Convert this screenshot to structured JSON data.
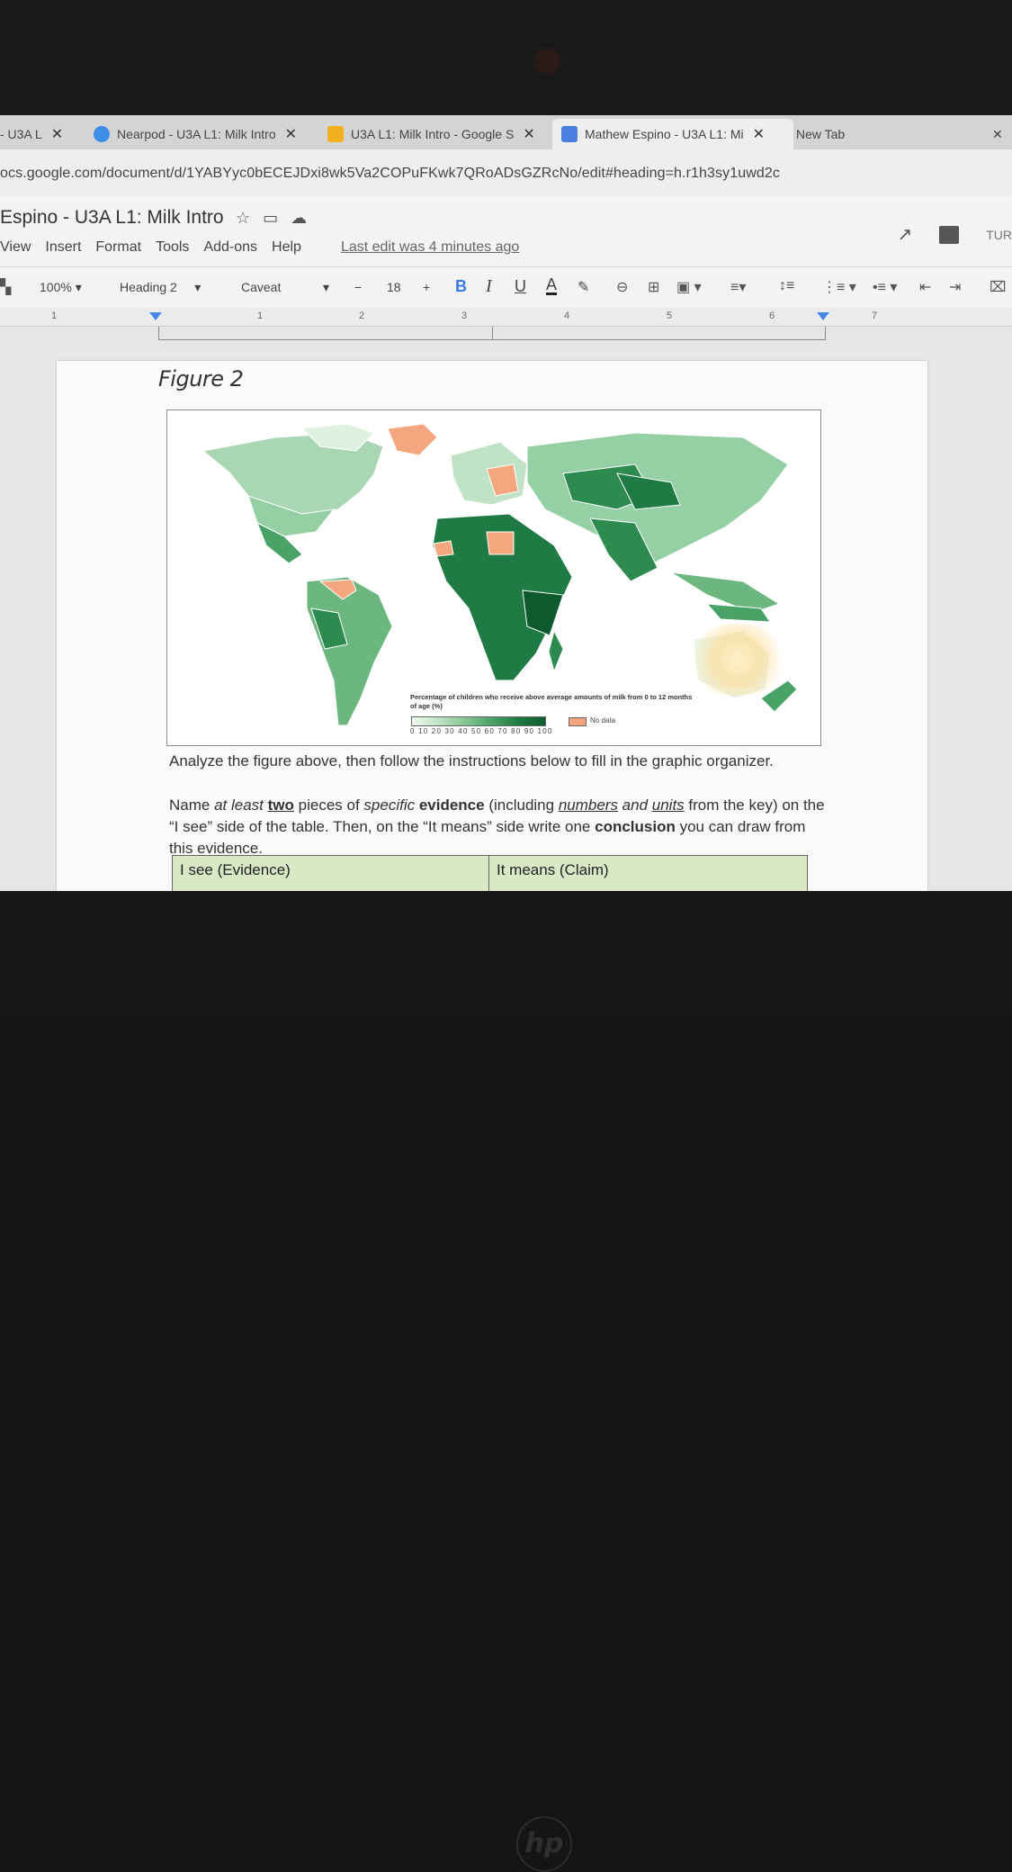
{
  "tabs": [
    {
      "label": "- U3A L",
      "favicon": "docs"
    },
    {
      "label": "Nearpod - U3A L1: Milk Intro",
      "favicon": "nearpod"
    },
    {
      "label": "U3A L1: Milk Intro - Google S",
      "favicon": "slides"
    },
    {
      "label": "Mathew Espino - U3A L1: Mi",
      "favicon": "docs"
    },
    {
      "label": "New Tab",
      "favicon": ""
    }
  ],
  "tab_close": "✕",
  "window_close": "✕",
  "url": "ocs.google.com/document/d/1YABYyc0bECEJDxi8wk5Va2COPuFKwk7QRoADsGZRcNo/edit#heading=h.r1h3sy1uwd2c",
  "doc": {
    "title": "Espino - U3A L1: Milk Intro",
    "menu": [
      "View",
      "Insert",
      "Format",
      "Tools",
      "Add-ons",
      "Help"
    ],
    "last_edit": "Last edit was 4 minutes ago",
    "turn_in": "TUR"
  },
  "toolbar": {
    "zoom": "100%",
    "style": "Heading 2",
    "font": "Caveat",
    "minus": "−",
    "font_size": "18",
    "plus": "+",
    "bold": "B",
    "italic": "I",
    "underline": "U",
    "text_color": "A"
  },
  "ruler": [
    "1",
    "1",
    "2",
    "3",
    "4",
    "5",
    "6",
    "7"
  ],
  "figure": {
    "heading": "Figure 2",
    "legend_title": "Percentage of children who receive above average amounts of milk from 0 to 12 months of age (%)",
    "legend_ticks": "0 10 20 30 40 50 60 70 80 90 100",
    "no_data_label": "No data"
  },
  "instructions": {
    "line1": "Analyze the figure above, then follow the instructions below to fill in the graphic organizer.",
    "p2_a": "Name ",
    "p2_b": "at least ",
    "p2_c": "two",
    "p2_d": " pieces of ",
    "p2_e": "specific ",
    "p2_f": "evidence",
    "p2_g": " (including ",
    "p2_h": "numbers",
    "p2_i": " and ",
    "p2_j": "units",
    "p2_k": " from the key) on the “I see” side of the table. Then, on the “It means” side write one ",
    "p2_l": "conclusion",
    "p2_m": " you can draw from this evidence."
  },
  "organizer": {
    "col1": "I see (Evidence)",
    "col2": "It means (Claim)"
  },
  "colors": {
    "accent": "#3b78e7",
    "no_data": "#f4a77f",
    "table_header": "#d9e8c5"
  }
}
